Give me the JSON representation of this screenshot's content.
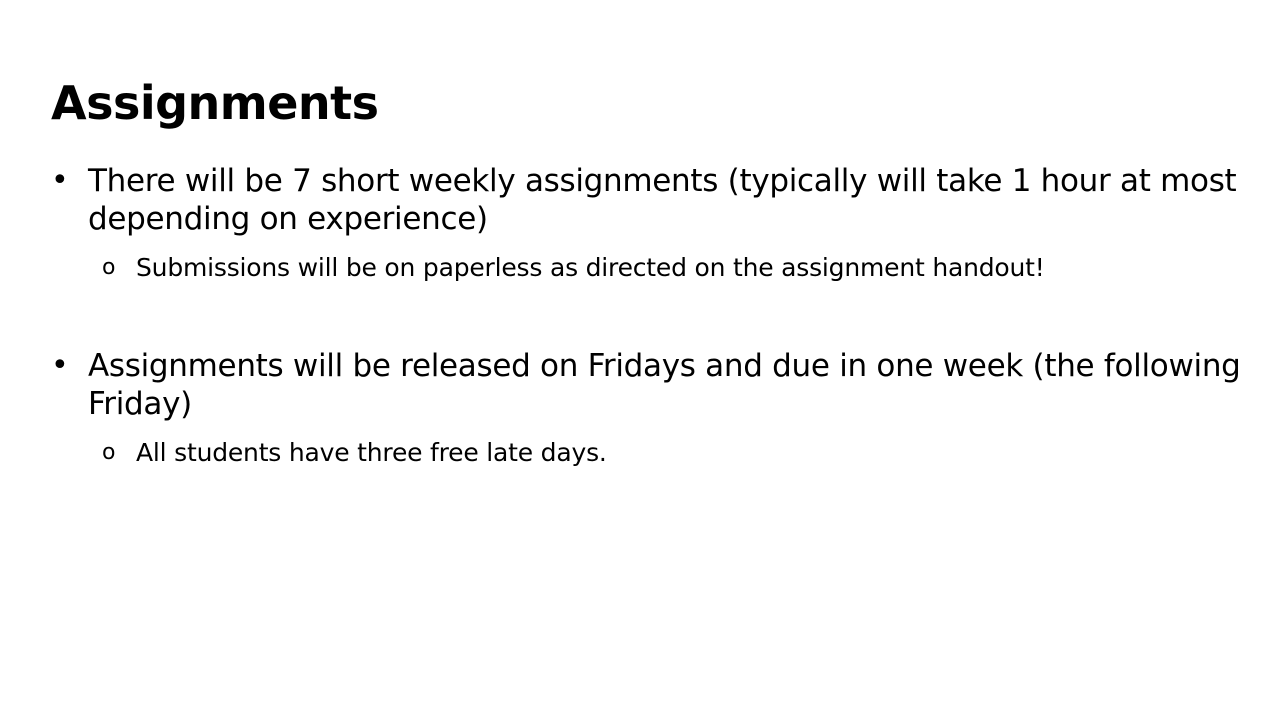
{
  "slide": {
    "title": "Assignments",
    "bullet_marker": "•",
    "sub_marker": "o",
    "bullets": [
      {
        "text": "There will be 7 short weekly assignments (typically will take 1 hour at most depending on experience)",
        "sub": [
          "Submissions will be on paperless as directed on the assignment handout!"
        ]
      },
      {
        "text": "Assignments will be released on Fridays and due in one week (the following Friday)",
        "sub": [
          "All students have three free late days."
        ]
      }
    ]
  }
}
